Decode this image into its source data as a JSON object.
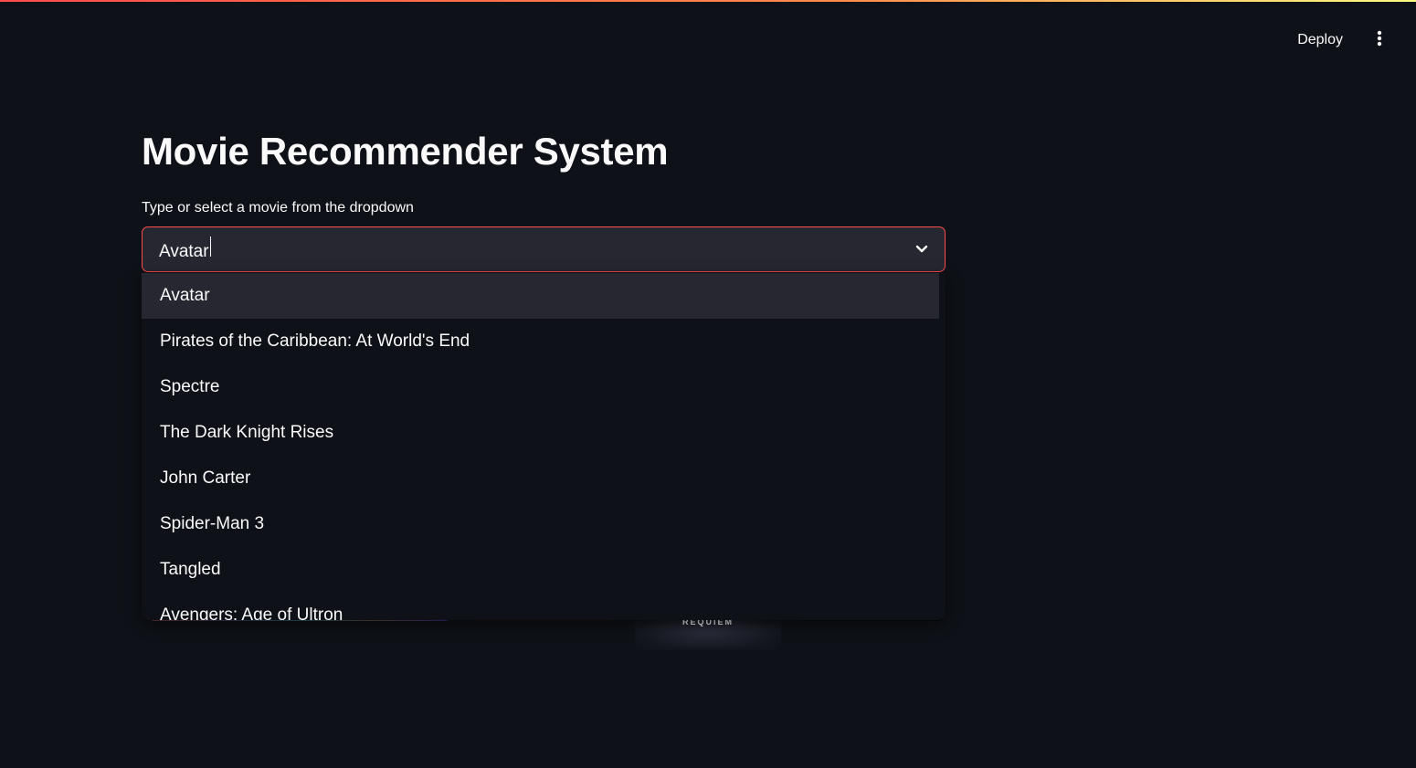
{
  "header": {
    "deploy_label": "Deploy",
    "menu_icon": "vertical-ellipsis-icon"
  },
  "main": {
    "title": "Movie Recommender System",
    "select_label": "Type or select a movie from the dropdown",
    "select_value": "Avatar"
  },
  "dropdown": {
    "items": [
      "Avatar",
      "Pirates of the Caribbean: At World's End",
      "Spectre",
      "The Dark Knight Rises",
      "John Carter",
      "Spider-Man 3",
      "Tangled",
      "Avengers: Age of Ultron"
    ],
    "highlighted": "Avatar"
  },
  "posters": {
    "visible_text": "REQUIEM"
  },
  "colors": {
    "background": "#0e1117",
    "input_bg": "#262730",
    "accent": "#ff4b4b",
    "text": "#fafafa"
  }
}
